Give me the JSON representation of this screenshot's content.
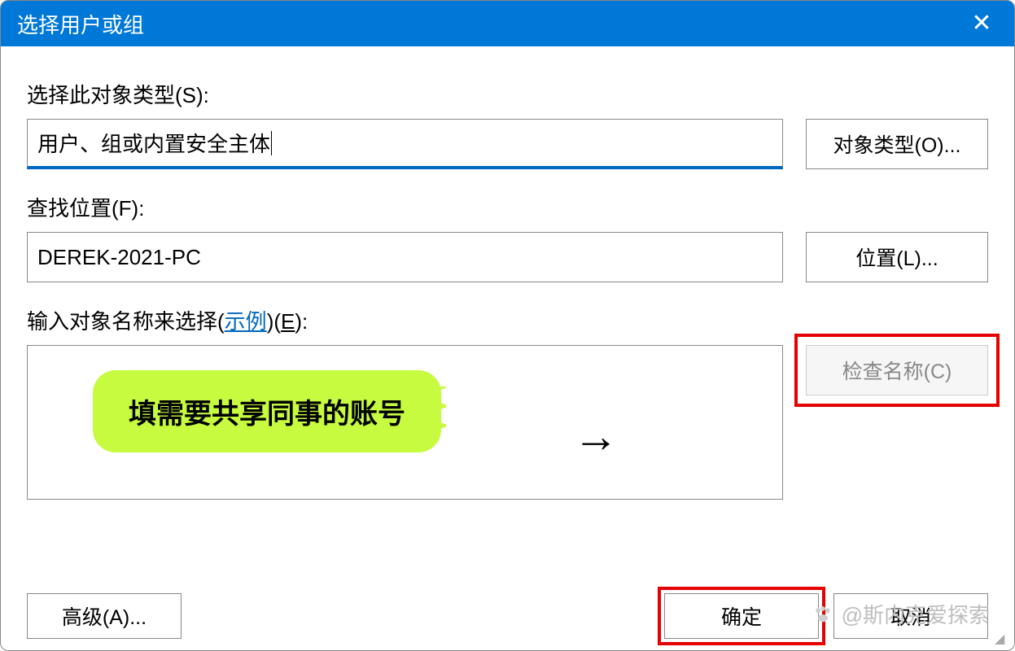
{
  "titlebar": {
    "title": "选择用户或组"
  },
  "labels": {
    "object_type": "选择此对象类型(S):",
    "location": "查找位置(F):",
    "enter_names_prefix": "输入对象名称来选择(",
    "example_link": "示例",
    "enter_names_suffix": ")(",
    "enter_names_hotkey": "E",
    "enter_names_end": "):"
  },
  "fields": {
    "object_type_value": "用户、组或内置安全主体",
    "location_value": "DEREK-2021-PC"
  },
  "buttons": {
    "object_types": "对象类型(O)...",
    "locations": "位置(L)...",
    "check_names": "检查名称(C)",
    "advanced": "高级(A)...",
    "ok": "确定",
    "cancel": "取消"
  },
  "annotation": {
    "bubble_text": "填需要共享同事的账号",
    "arrow": "→"
  },
  "watermark": {
    "text": "@斯内克爱探索"
  }
}
